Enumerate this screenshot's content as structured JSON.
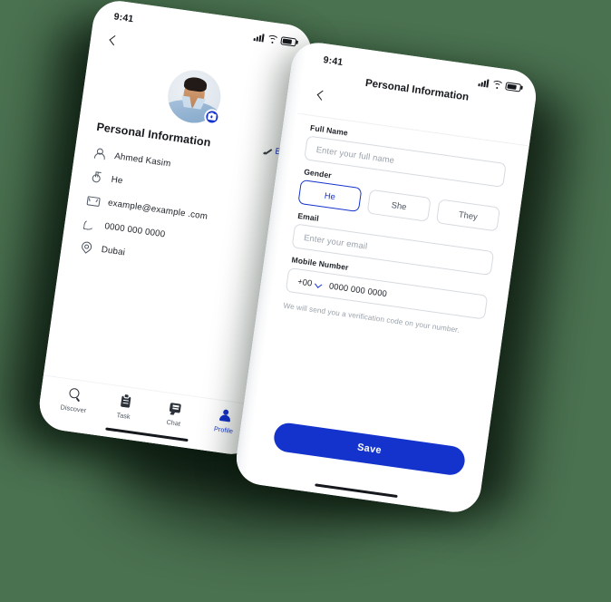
{
  "background_color": "#4a7150",
  "accent_color": "#1433cc",
  "left_phone": {
    "status": {
      "time": "9:41",
      "signal_icon": "signal-bars-icon",
      "wifi_icon": "wifi-icon",
      "battery_icon": "battery-icon"
    },
    "back_icon": "chevron-left-icon",
    "avatar": {
      "name": "avatar",
      "camera_badge_icon": "camera-icon"
    },
    "section_title": "Personal Information",
    "edit": {
      "label": "E",
      "icon": "pencil-icon"
    },
    "info_rows": [
      {
        "icon": "person-icon",
        "value": "Ahmed Kasim"
      },
      {
        "icon": "gender-icon",
        "value": "He"
      },
      {
        "icon": "mail-icon",
        "value": "example@example .com"
      },
      {
        "icon": "phone-icon",
        "value": "0000 000 0000"
      },
      {
        "icon": "location-pin-icon",
        "value": "Dubai"
      }
    ],
    "tabs": [
      {
        "label": "Discover",
        "icon": "search-icon",
        "active": false
      },
      {
        "label": "Task",
        "icon": "clipboard-icon",
        "active": false
      },
      {
        "label": "Chat",
        "icon": "chat-bubble-icon",
        "active": false
      },
      {
        "label": "Profile",
        "icon": "profile-icon",
        "active": true
      }
    ]
  },
  "right_phone": {
    "status": {
      "time": "9:41",
      "signal_icon": "signal-bars-icon",
      "wifi_icon": "wifi-icon",
      "battery_icon": "battery-icon"
    },
    "back_icon": "chevron-left-icon",
    "title": "Personal Information",
    "full_name": {
      "label": "Full Name",
      "placeholder": "Enter your full name",
      "value": ""
    },
    "gender": {
      "label": "Gender",
      "options": [
        {
          "label": "He",
          "selected": true
        },
        {
          "label": "She",
          "selected": false
        },
        {
          "label": "They",
          "selected": false
        }
      ]
    },
    "email": {
      "label": "Email",
      "placeholder": "Enter your email",
      "value": ""
    },
    "mobile": {
      "label": "Mobile Number",
      "country_code": "+00",
      "chevron_icon": "chevron-down-icon",
      "value": "0000 000 0000"
    },
    "hint": "We will send you a verification code on your number.",
    "save_label": "Save"
  }
}
